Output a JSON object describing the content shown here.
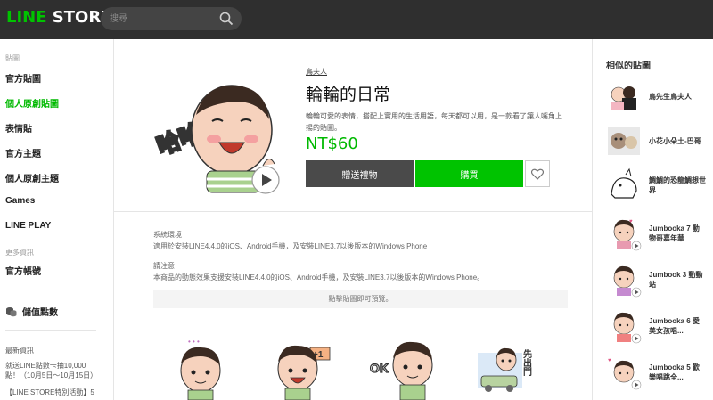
{
  "header": {
    "logo_line": "LINE",
    "logo_store": " STORE",
    "search_placeholder": "搜尋",
    "search_icon": "search-icon"
  },
  "sidebar": {
    "section_label": "貼圖",
    "items": [
      {
        "label": "官方貼圖"
      },
      {
        "label": "個人原創貼圖",
        "active": true
      },
      {
        "label": "表情貼"
      },
      {
        "label": "官方主題"
      },
      {
        "label": "個人原創主題"
      },
      {
        "label": "Games"
      },
      {
        "label": "LINE PLAY"
      }
    ],
    "more_label": "更多資訊",
    "official_account": "官方帳號",
    "points_label": "儲值點數",
    "news_title": "最新資訊",
    "news_items": [
      "就送LINE點數卡抽10,000點！（10月5日～10月15日）",
      "【LINE STORE特別活動】5"
    ]
  },
  "product": {
    "author": "鳥夫人",
    "title": "輪輪的日常",
    "description": "輪輪可愛的表情，搭配上實用的生活用語，每天都可以用，是一款看了讓人嘴角上揚的貼圖。",
    "price": "NT$60",
    "gift_label": "贈送禮物",
    "buy_label": "購買",
    "hero_text": "哈哈",
    "env_label": "系統環境",
    "env_text": "適用於安裝LINE4.4.0的iOS、Android手機，及安裝LINE3.7以後版本的Windows Phone",
    "notice_label": "請注意",
    "notice_text": "本商品的動態效果支援安裝LINE4.4.0的iOS、Android手機，及安裝LINE3.7以後版本的Windows Phone。",
    "preview_hint": "點擊貼圖即可預覽。",
    "sticker_texts": [
      "+1",
      "OK",
      "先出門"
    ]
  },
  "similar": {
    "title": "相似的貼圖",
    "items": [
      {
        "name": "鳥先生鳥夫人"
      },
      {
        "name": "小花小朵土-巴哥"
      },
      {
        "name": "鯛鯛的恐龍鯛想世界"
      },
      {
        "name": "Jumbooka 7 動物哥嘉年華"
      },
      {
        "name": "Jumbook 3 動動站"
      },
      {
        "name": "Jumbooka 6 愛美女孩唱..."
      },
      {
        "name": "Jumbooka 5 歡樂唱跳全..."
      }
    ]
  },
  "colors": {
    "header_bg": "#2f2f2f",
    "brand_green": "#00c300",
    "price_green": "#00b900",
    "gift_button": "#4a4a4a"
  }
}
